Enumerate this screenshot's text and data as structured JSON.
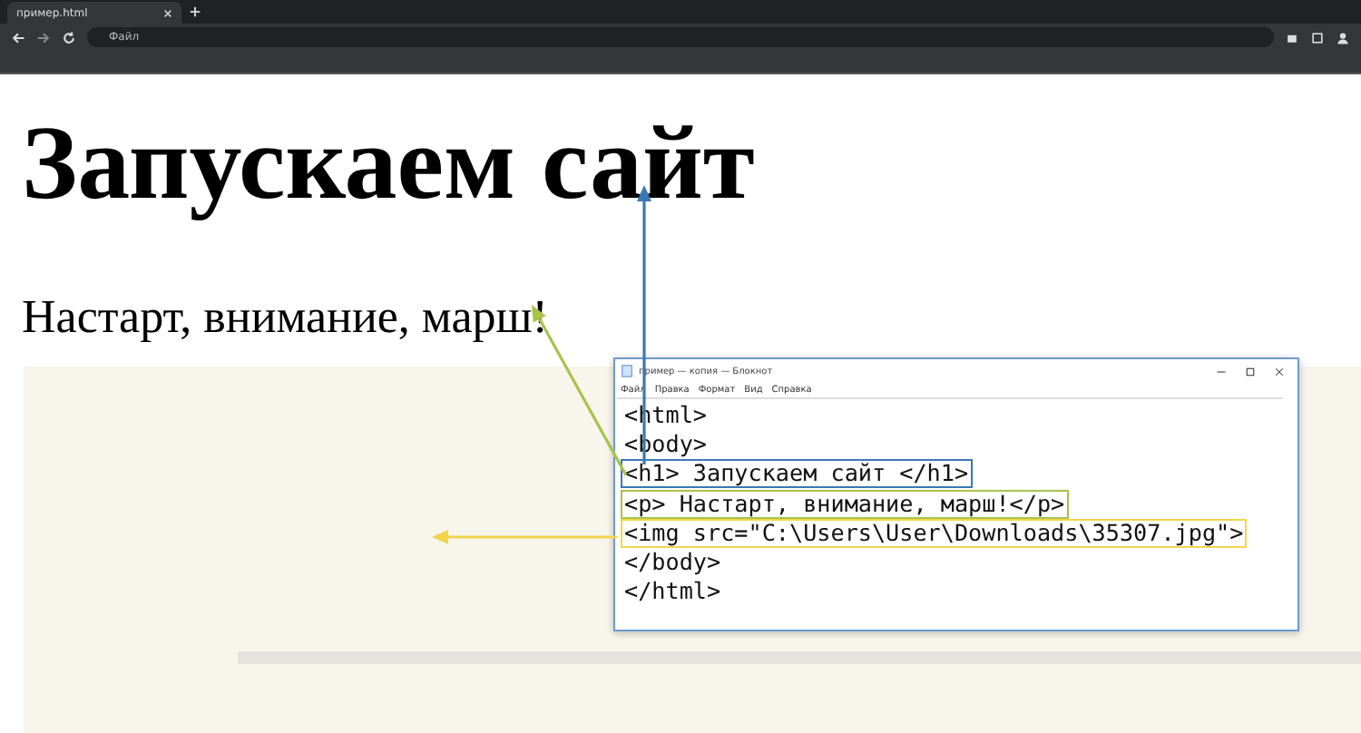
{
  "browser": {
    "tab": {
      "title": "пример.html",
      "selected": true
    },
    "address": {
      "scheme_label": "Файл"
    }
  },
  "page": {
    "heading": "Запускаем сайт",
    "paragraph": "Настарт, внимание, марш!"
  },
  "notepad": {
    "title": "пример — копия — Блокнот",
    "menu": [
      "Файл",
      "Правка",
      "Формат",
      "Вид",
      "Справка"
    ],
    "lines": [
      {
        "text": "<html>"
      },
      {
        "text": "<body>"
      },
      {
        "text": "<h1> Запускаем сайт </h1>",
        "color": "#3a78b5",
        "kind": "heading"
      },
      {
        "text": "<p> Настарт, внимание, марш!</p>",
        "color": "#a8c34a",
        "kind": "paragraph"
      },
      {
        "text": "<img src=\"C:\\Users\\User\\Downloads\\35307.jpg\">",
        "color": "#f2d44c"
      },
      {
        "text": "</body>"
      },
      {
        "text": "</html>"
      }
    ]
  }
}
